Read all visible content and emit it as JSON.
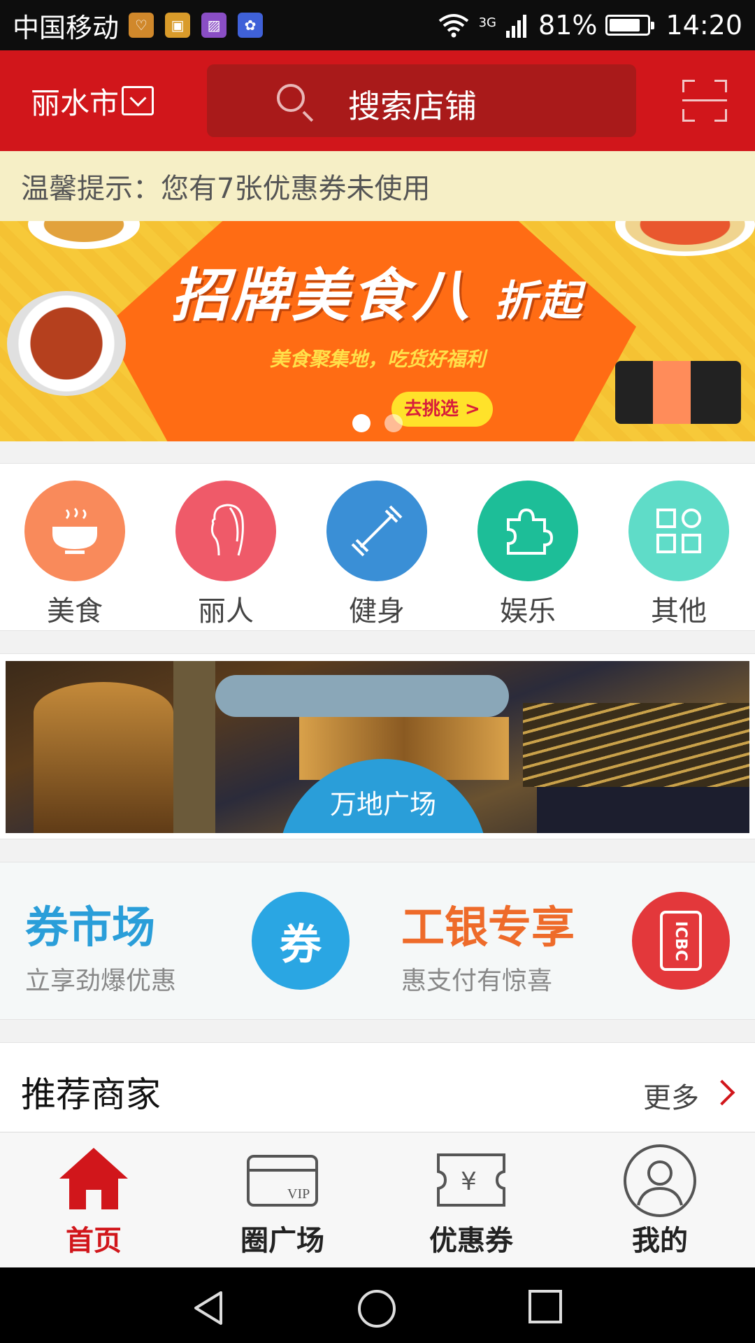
{
  "status_bar": {
    "carrier": "中国移动",
    "network": "3G",
    "battery": "81%",
    "battery_level": 0.81,
    "time": "14:20"
  },
  "header": {
    "city": "丽水市",
    "search_placeholder": "搜索店铺"
  },
  "notice": {
    "text": "温馨提示：您有7张优惠券未使用"
  },
  "banner": {
    "headline": "招牌美食八",
    "headline_suffix": "折起",
    "subtitle": "美食聚集地，吃货好福利",
    "cta": "去挑选 >",
    "slide_count": 2,
    "active_slide": 1
  },
  "categories": [
    {
      "label": "美食",
      "color": "#f98a5b",
      "icon": "bowl-icon"
    },
    {
      "label": "丽人",
      "color": "#ef5a69",
      "icon": "woman-profile-icon"
    },
    {
      "label": "健身",
      "color": "#3a8fd6",
      "icon": "dumbbell-icon"
    },
    {
      "label": "娱乐",
      "color": "#1dbe98",
      "icon": "puzzle-icon"
    },
    {
      "label": "其他",
      "color": "#5fdcc8",
      "icon": "grid-icon"
    }
  ],
  "plaza": {
    "label": "万地广场"
  },
  "promos": [
    {
      "title": "券市场",
      "subtitle": "立享劲爆优惠",
      "badge": "券",
      "title_color": "#2a9ed9",
      "badge_color": "#2aa6e3"
    },
    {
      "title": "工银专享",
      "subtitle": "惠支付有惊喜",
      "badge": "ICBC",
      "title_color": "#ee6b2a",
      "badge_color": "#e3383b"
    }
  ],
  "recommend": {
    "title": "推荐商家",
    "more": "更多"
  },
  "tabs": [
    {
      "label": "首页",
      "icon": "home-icon",
      "active": true
    },
    {
      "label": "圈广场",
      "icon": "vip-card-icon",
      "active": false
    },
    {
      "label": "优惠券",
      "icon": "coupon-icon",
      "active": false
    },
    {
      "label": "我的",
      "icon": "profile-icon",
      "active": false
    }
  ],
  "colors": {
    "brand_red": "#d1161b",
    "notice_bg": "#f6efc6"
  }
}
